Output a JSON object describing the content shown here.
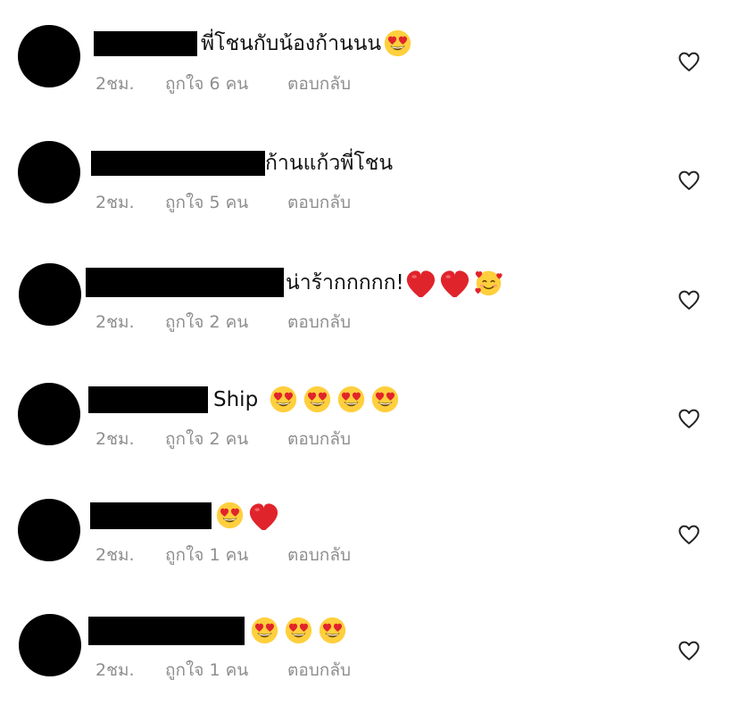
{
  "comments": [
    {
      "text": "พี่โชนกับน้องก้านนน",
      "emojis": [
        "heart-eyes-face"
      ],
      "time": "2ชม.",
      "likes": "ถูกใจ 6 คน",
      "reply": "ตอบกลับ"
    },
    {
      "text": "ก้านแก้วพี่โชน",
      "emojis": [],
      "time": "2ชม.",
      "likes": "ถูกใจ 5 คน",
      "reply": "ตอบกลับ"
    },
    {
      "text": "น่าร้ากกกกก!",
      "emojis": [
        "red-heart",
        "red-heart",
        "smiling-face-with-hearts"
      ],
      "time": "2ชม.",
      "likes": "ถูกใจ 2 คน",
      "reply": "ตอบกลับ"
    },
    {
      "text": "Ship",
      "emojis": [
        "heart-eyes-face",
        "heart-eyes-face",
        "heart-eyes-face",
        "heart-eyes-face"
      ],
      "time": "2ชม.",
      "likes": "ถูกใจ 2 คน",
      "reply": "ตอบกลับ"
    },
    {
      "text": "",
      "emojis": [
        "heart-eyes-face",
        "red-heart"
      ],
      "time": "2ชม.",
      "likes": "ถูกใจ 1 คน",
      "reply": "ตอบกลับ"
    },
    {
      "text": "",
      "emojis": [
        "heart-eyes-face",
        "heart-eyes-face",
        "heart-eyes-face"
      ],
      "time": "2ชม.",
      "likes": "ถูกใจ 1 คน",
      "reply": "ตอบกลับ"
    }
  ],
  "icons": {
    "like_button": "heart-outline-icon"
  },
  "colors": {
    "text": "#111111",
    "meta": "#8e8e8e",
    "redaction": "#000000",
    "heart": "#e0242b",
    "emoji_face": "#ffcf3d"
  }
}
